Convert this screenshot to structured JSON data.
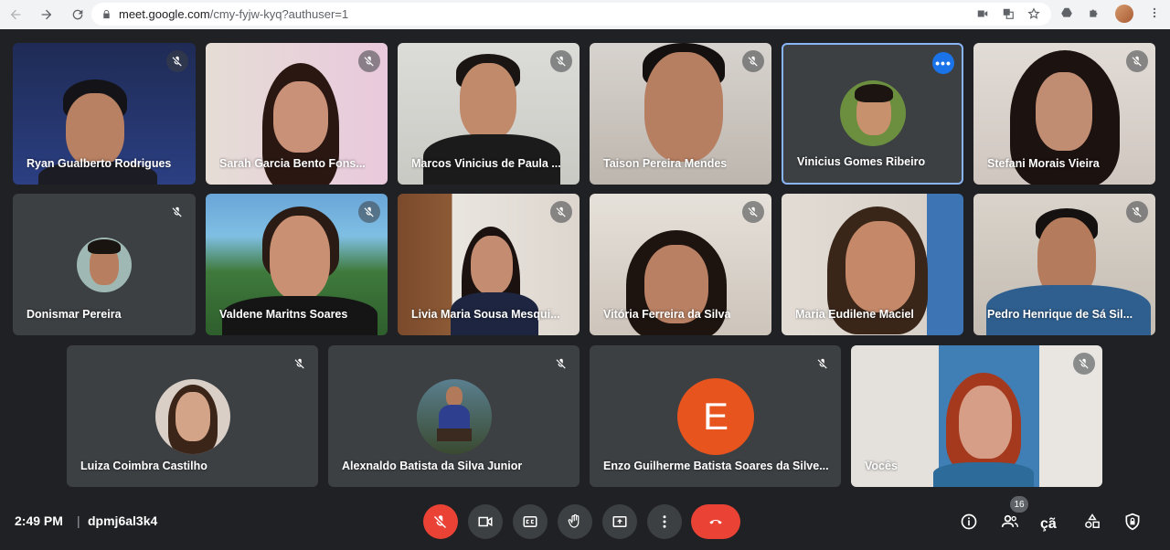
{
  "browser": {
    "url_host": "meet.google.com",
    "url_path": "/cmy-fyjw-kyq?authuser=1"
  },
  "participants": [
    {
      "name": "Ryan Gualberto Rodrigues"
    },
    {
      "name": "Sarah Garcia Bento Fons..."
    },
    {
      "name": "Marcos Vinicius de Paula ..."
    },
    {
      "name": "Taison Pereira Mendes"
    },
    {
      "name": "Vinicius Gomes Ribeiro"
    },
    {
      "name": "Stefani Morais Vieira"
    },
    {
      "name": "Donismar Pereira"
    },
    {
      "name": "Valdene Maritns Soares"
    },
    {
      "name": "Livia Maria Sousa Mesqui..."
    },
    {
      "name": "Vitória Ferreira da Silva"
    },
    {
      "name": "Maria Eudilene Maciel"
    },
    {
      "name": "Pedro Henrique de Sá Sil..."
    },
    {
      "name": "Luiza Coimbra Castilho"
    },
    {
      "name": "Alexnaldo Batista da Silva Junior"
    },
    {
      "name": "Enzo Guilherme Batista Soares da Silve...",
      "initial": "E"
    },
    {
      "name": "Vocês"
    }
  ],
  "bottombar": {
    "time": "2:49 PM",
    "separator": "|",
    "meeting_code": "dpmj6al3k4",
    "participants_count": "16",
    "lang_icon_text": "çã"
  },
  "colors": {
    "background": "#202124",
    "tile": "#3c4043",
    "hangup": "#ea4335",
    "mic_off": "#ea4335",
    "active_border": "#8ab4f8",
    "enzo_avatar": "#e8541e",
    "more_button": "#1a73e8"
  }
}
